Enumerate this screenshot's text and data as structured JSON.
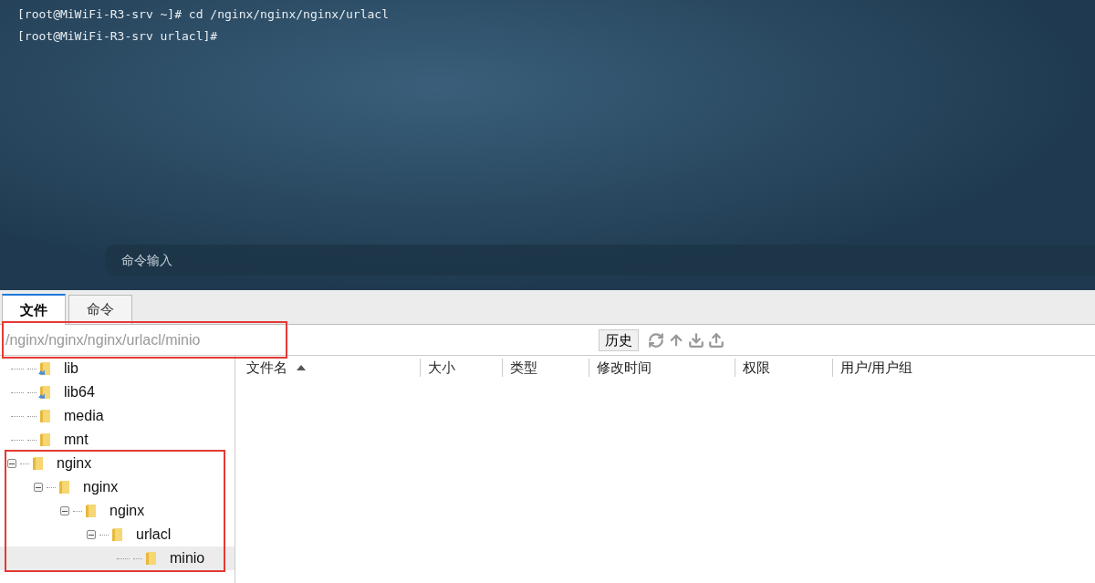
{
  "terminal": {
    "lines": [
      "[root@MiWiFi-R3-srv ~]# cd /nginx/nginx/nginx/urlacl",
      "[root@MiWiFi-R3-srv urlacl]#"
    ],
    "command_input": {
      "placeholder": "命令输入"
    }
  },
  "tabs": [
    {
      "label": "文件",
      "selected": true
    },
    {
      "label": "命令",
      "selected": false
    }
  ],
  "path_bar": {
    "value": "/nginx/nginx/nginx/urlacl/minio",
    "history_button": "历史"
  },
  "tree": [
    {
      "name": "lib",
      "kind": "link",
      "selected": false
    },
    {
      "name": "lib64",
      "kind": "link",
      "selected": false
    },
    {
      "name": "media",
      "kind": "folder",
      "selected": false
    },
    {
      "name": "mnt",
      "kind": "folder",
      "selected": false
    },
    {
      "name": "nginx",
      "kind": "folder",
      "selected": false,
      "expanded": true,
      "children": [
        {
          "name": "nginx",
          "kind": "folder",
          "selected": false,
          "expanded": true,
          "children": [
            {
              "name": "nginx",
              "kind": "folder",
              "selected": false,
              "expanded": true,
              "children": [
                {
                  "name": "urlacl",
                  "kind": "folder",
                  "selected": false,
                  "expanded": true,
                  "children": [
                    {
                      "name": "minio",
                      "kind": "folder",
                      "selected": true
                    }
                  ]
                }
              ]
            }
          ]
        }
      ]
    }
  ],
  "file_table": {
    "columns": [
      {
        "label": "文件名",
        "sorted": true
      },
      {
        "label": "大小",
        "sorted": false
      },
      {
        "label": "类型",
        "sorted": false
      },
      {
        "label": "修改时间",
        "sorted": false
      },
      {
        "label": "权限",
        "sorted": false
      },
      {
        "label": "用户/用户组",
        "sorted": false
      }
    ]
  }
}
